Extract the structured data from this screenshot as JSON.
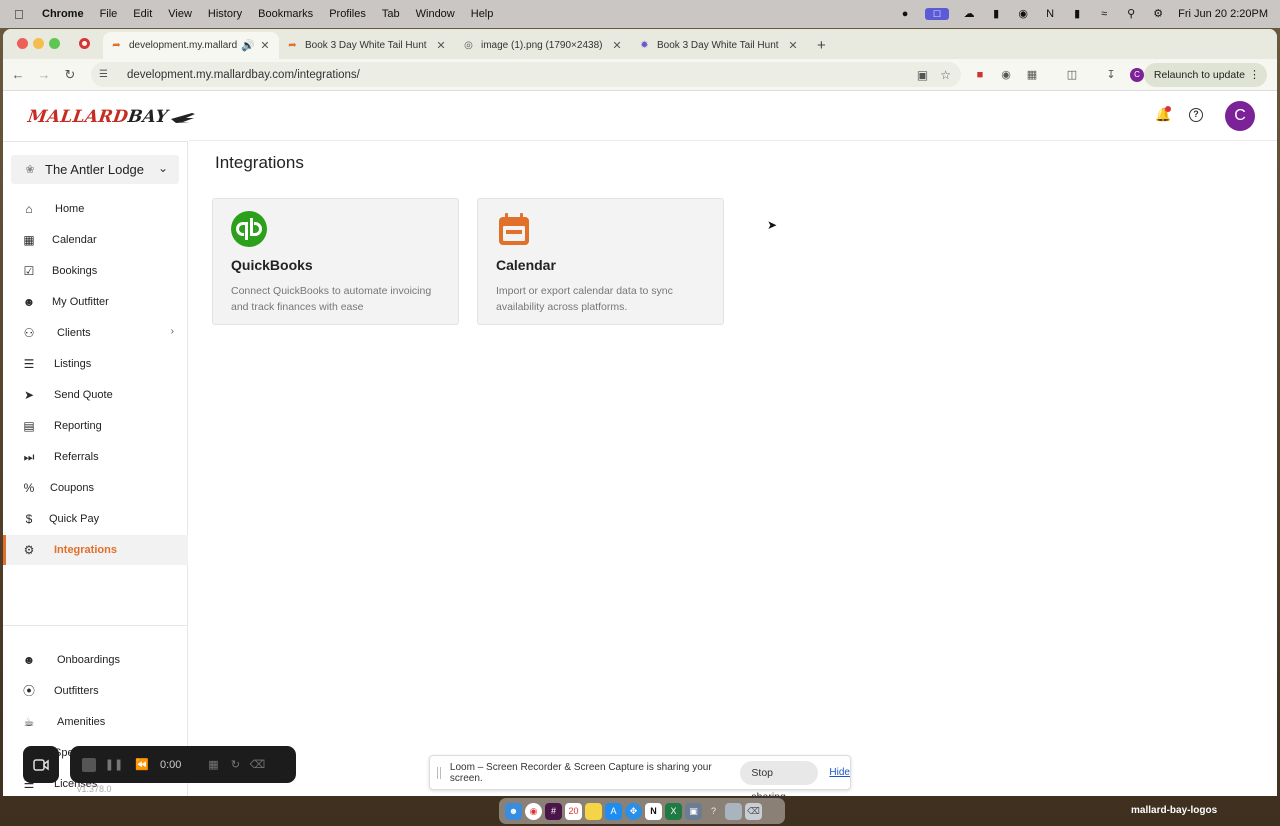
{
  "menubar": {
    "app": "Chrome",
    "items": [
      "File",
      "Edit",
      "View",
      "History",
      "Bookmarks",
      "Profiles",
      "Tab",
      "Window",
      "Help"
    ],
    "clock": "Fri Jun 20  2:20PM"
  },
  "tabs": [
    {
      "title": "development.my.mallardb"
    },
    {
      "title": "Book 3 Day White Tail Hunt -"
    },
    {
      "title": "image (1).png (1790×2438)"
    },
    {
      "title": "Book 3 Day White Tail Hunt -"
    }
  ],
  "address": {
    "url": "development.my.mallardbay.com/integrations/"
  },
  "relaunch": "Relaunch to update",
  "profile_initial": "C",
  "brand": {
    "word1": "MALLARD",
    "word2": "BAY"
  },
  "lodge": "The Antler Lodge",
  "nav": {
    "main": [
      "Home",
      "Calendar",
      "Bookings",
      "My Outfitter",
      "Clients",
      "Listings",
      "Send Quote",
      "Reporting",
      "Referrals",
      "Coupons",
      "Quick Pay",
      "Integrations"
    ],
    "admin": [
      "Onboardings",
      "Outfitters",
      "Amenities",
      "Species",
      "Licenses"
    ],
    "active": "Integrations"
  },
  "version": "v1.378.0",
  "avatar_initial": "C",
  "page_title": "Integrations",
  "cards": [
    {
      "title": "QuickBooks",
      "description": "Connect QuickBooks to automate invoicing and track finances with ease",
      "icon": "quickbooks-logo-icon"
    },
    {
      "title": "Calendar",
      "description": "Import or export calendar data to sync availability across platforms.",
      "icon": "calendar-icon"
    }
  ],
  "loom": {
    "timer": "0:00",
    "message": "Loom – Screen Recorder & Screen Capture is sharing your screen.",
    "stop_label": "Stop sharing",
    "hide_label": "Hide"
  },
  "desktop_label": "mallard-bay-logos",
  "colors": {
    "accent": "#e0702a",
    "quickbooks": "#2ca01c",
    "avatar": "#7b2298",
    "brand_red": "#c62c22"
  }
}
